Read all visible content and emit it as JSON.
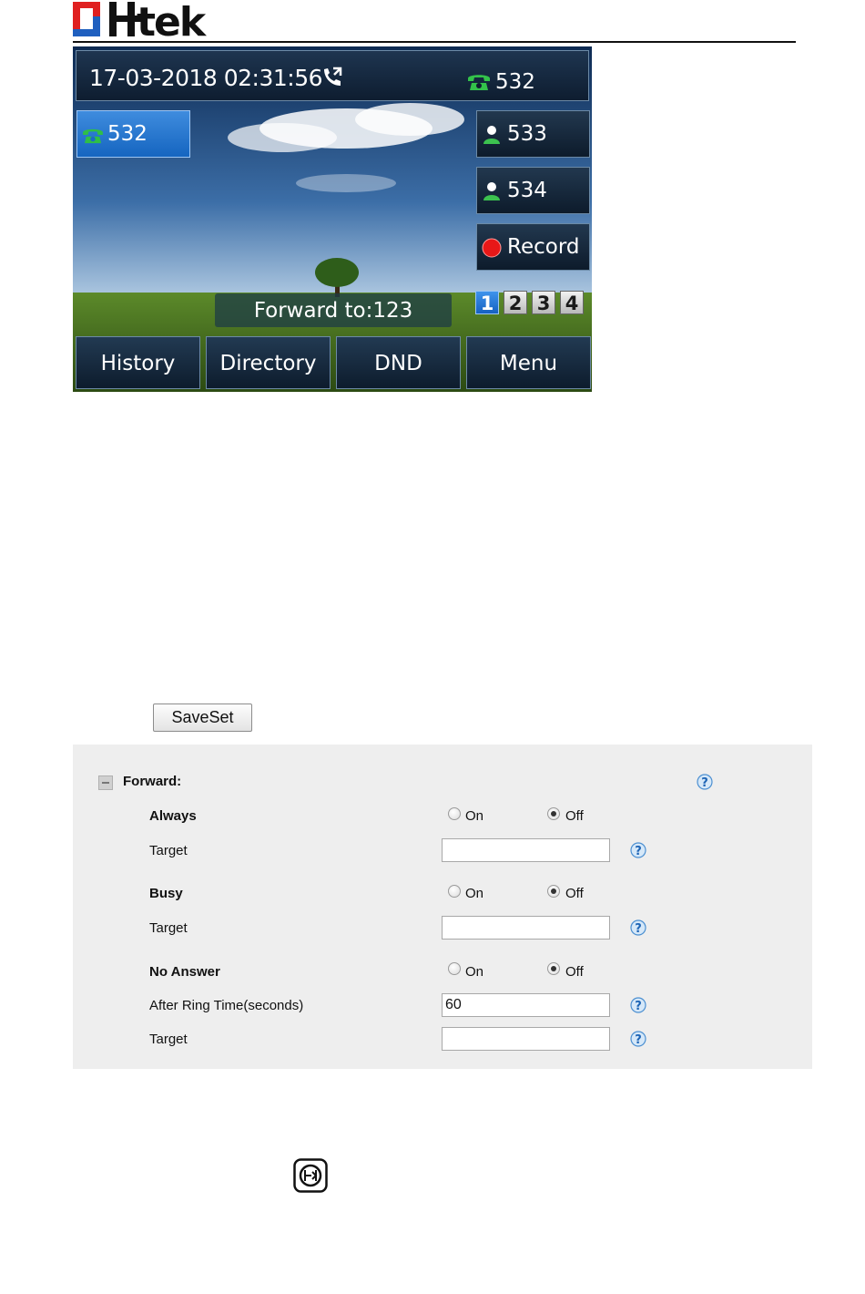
{
  "header": {
    "logo_text": "Htek",
    "logo_colors": {
      "red": "#e02020",
      "blue": "#1f5fbf",
      "black": "#111111"
    }
  },
  "phone_screen": {
    "status_bar": {
      "datetime": "17-03-2018 02:31:56",
      "forward_icon": "call-forward-icon",
      "line_icon": "phone-handset-icon",
      "line_number": "532"
    },
    "left_line_key": {
      "icon": "phone-handset-icon",
      "label": "532",
      "selected": true
    },
    "right_keys": [
      {
        "icon": "contact-person-icon",
        "label": "533"
      },
      {
        "icon": "contact-person-icon",
        "label": "534"
      },
      {
        "icon": "record-dot-icon",
        "label": "Record"
      }
    ],
    "forward_banner": "Forward to:123",
    "pages": [
      "1",
      "2",
      "3",
      "4"
    ],
    "active_page": "1",
    "softkeys": [
      "History",
      "Directory",
      "DND",
      "Menu"
    ]
  },
  "saveset_button": "SaveSet",
  "forward_panel": {
    "title": "Forward:",
    "sections": [
      {
        "name": "Always",
        "options": [
          "On",
          "Off"
        ],
        "selected": "Off",
        "fields": [
          {
            "label": "Target",
            "value": ""
          }
        ]
      },
      {
        "name": "Busy",
        "options": [
          "On",
          "Off"
        ],
        "selected": "Off",
        "fields": [
          {
            "label": "Target",
            "value": ""
          }
        ]
      },
      {
        "name": "No Answer",
        "options": [
          "On",
          "Off"
        ],
        "selected": "Off",
        "fields": [
          {
            "label": "After Ring Time(seconds)",
            "value": "60"
          },
          {
            "label": "Target",
            "value": ""
          }
        ]
      }
    ]
  },
  "bottom_icon": "forward-key-icon"
}
